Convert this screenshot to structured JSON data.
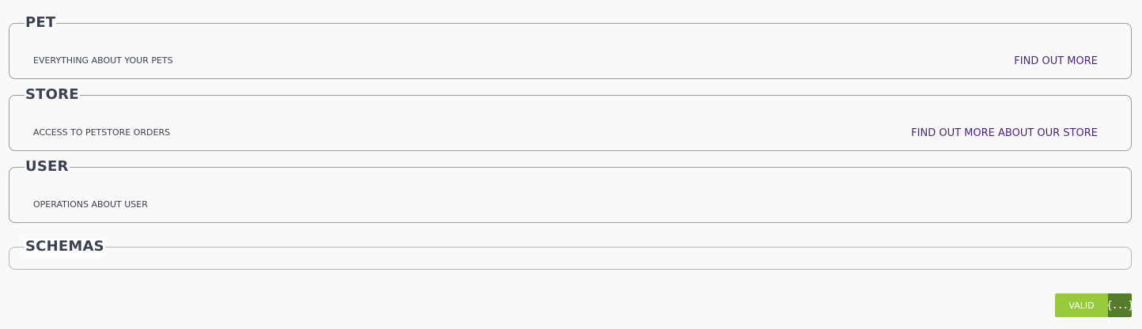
{
  "sections": [
    {
      "title": "PET",
      "description": "EVERYTHING ABOUT YOUR PETS",
      "link": "FIND OUT MORE"
    },
    {
      "title": "STORE",
      "description": "ACCESS TO PETSTORE ORDERS",
      "link": "FIND OUT MORE ABOUT OUR STORE"
    },
    {
      "title": "USER",
      "description": "OPERATIONS ABOUT USER"
    },
    {
      "title": "SCHEMAS"
    }
  ],
  "validator": {
    "label": "VALID",
    "icon": "{...}",
    "icon_name": "json-braces-icon"
  },
  "colors": {
    "link": "#4b1f7a",
    "valid_badge": "#97c93d",
    "valid_icon_bg": "#557b2b"
  }
}
